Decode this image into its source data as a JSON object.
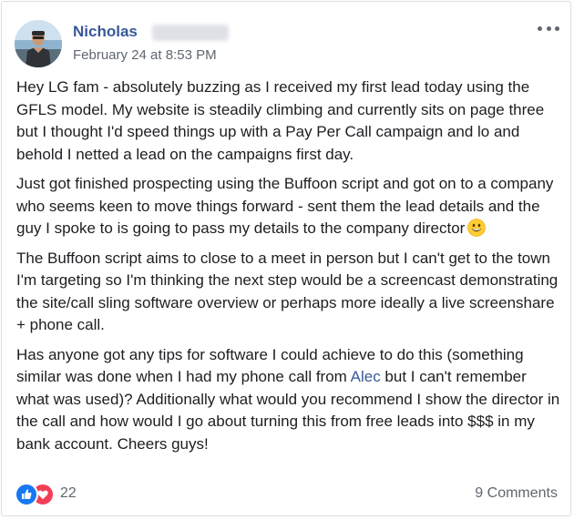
{
  "post": {
    "author_name": "Nicholas",
    "timestamp": "February 24 at 8:53 PM",
    "paragraphs": {
      "p1": "Hey LG fam - absolutely buzzing as I received my first lead today using the GFLS model. My website is steadily climbing and currently sits on page three but I thought I'd speed things up with a Pay Per Call campaign and lo and behold I netted a lead on the campaigns first day.",
      "p2": "Just got finished prospecting using the Buffoon script and got on to a company who seems keen to move things forward - sent them the lead details and the guy I spoke to is going to pass my details to the company director",
      "p3": "The Buffoon script aims to close to a meet in person but I can't get to the town I'm targeting so I'm thinking the next step would be a screencast demonstrating the site/call sling software overview or perhaps more ideally a live screenshare + phone call.",
      "p4_before": "Has anyone got any tips for software I could achieve to do this (something similar was done when I had my phone call from ",
      "p4_mention": "Alec",
      "p4_after": " but I can't remember what was used)? Additionally what would you recommend I show the director in the call and how would I go about turning this from free leads into $$$ in my bank account. Cheers guys!"
    },
    "emoji": "grinning-face",
    "reactions": {
      "types": [
        "like",
        "love"
      ],
      "count": "22"
    },
    "comments_label": "9 Comments",
    "colors": {
      "link": "#385898",
      "like": "#1877f2",
      "love": "#f33e58",
      "meta": "#606770"
    }
  }
}
